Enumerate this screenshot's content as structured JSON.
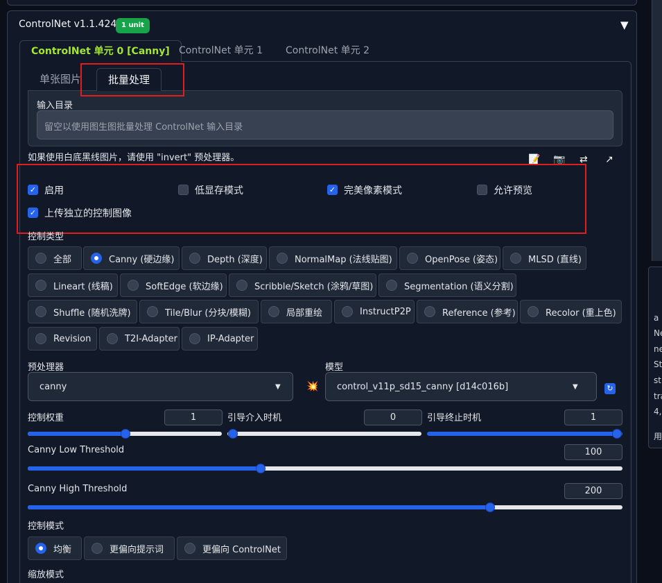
{
  "header": {
    "title": "ControlNet v1.1.424",
    "badge": "1 unit",
    "collapse_icon": "▼"
  },
  "unit_tabs": [
    "ControlNet 单元 0 [Canny]",
    "ControlNet 单元 1",
    "ControlNet 单元 2"
  ],
  "sub_tabs": [
    "单张图片",
    "批量处理"
  ],
  "batch": {
    "label": "输入目录",
    "placeholder": "留空以使用图生图批量处理 ControlNet 输入目录"
  },
  "info_text": "如果使用白底黑线图片，请使用 \"invert\" 预处理器。",
  "tool_icons": [
    "📝",
    "📷",
    "⇄",
    "↗"
  ],
  "checkboxes": [
    {
      "label": "启用",
      "checked": true
    },
    {
      "label": "低显存模式",
      "checked": false
    },
    {
      "label": "完美像素模式",
      "checked": true
    },
    {
      "label": "允许预览",
      "checked": false
    },
    {
      "label": "上传独立的控制图像",
      "checked": true
    }
  ],
  "control_type": {
    "label": "控制类型",
    "options": [
      "全部",
      "Canny (硬边缘)",
      "Depth (深度)",
      "NormalMap (法线贴图)",
      "OpenPose (姿态)",
      "MLSD (直线)",
      "Lineart (线稿)",
      "SoftEdge (软边缘)",
      "Scribble/Sketch (涂鸦/草图)",
      "Segmentation (语义分割)",
      "Shuffle (随机洗牌)",
      "Tile/Blur (分块/模糊)",
      "局部重绘",
      "InstructP2P",
      "Reference (参考)",
      "Recolor (重上色)",
      "Revision",
      "T2I-Adapter",
      "IP-Adapter"
    ],
    "selected": "Canny (硬边缘)"
  },
  "preprocessor": {
    "label": "预处理器",
    "value": "canny"
  },
  "model": {
    "label": "模型",
    "value": "control_v11p_sd15_canny [d14c016b]"
  },
  "sliders": {
    "weight": {
      "label": "控制权重",
      "value": "1"
    },
    "start": {
      "label": "引导介入时机",
      "value": "0"
    },
    "end": {
      "label": "引导终止时机",
      "value": "1"
    },
    "low": {
      "label": "Canny Low Threshold",
      "value": "100"
    },
    "high": {
      "label": "Canny High Threshold",
      "value": "200"
    }
  },
  "control_mode": {
    "label": "控制模式",
    "options": [
      "均衡",
      "更偏向提示词",
      "更偏向 ControlNet"
    ],
    "selected": "均衡"
  },
  "resize_mode": {
    "label": "缩放模式"
  },
  "side_text": [
    "a p",
    "Ne",
    "ne",
    "St",
    "st",
    "tra",
    "4,",
    "用"
  ],
  "colors": {
    "accent": "#2563eb",
    "highlight": "#e11d1d",
    "badge": "#16a34a",
    "active_tab": "#a3e635"
  }
}
